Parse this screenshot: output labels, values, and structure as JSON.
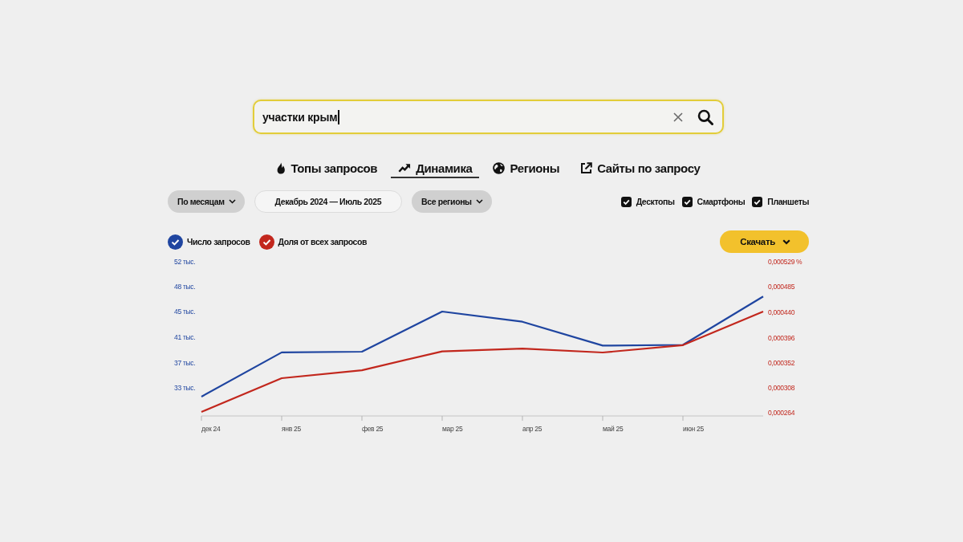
{
  "search": {
    "value": "участки крым"
  },
  "tabs": [
    {
      "label": "Топы запросов",
      "selected": false
    },
    {
      "label": "Динамика",
      "selected": true
    },
    {
      "label": "Регионы",
      "selected": false
    },
    {
      "label": "Сайты по запросу",
      "selected": false
    }
  ],
  "filters": [
    {
      "kind": "dropdown",
      "label": "По месяцам"
    },
    {
      "kind": "range",
      "label": "Декабрь 2024 — Июль 2025"
    },
    {
      "kind": "dropdown",
      "label": "Все регионы"
    }
  ],
  "devices": [
    {
      "label": "Десктопы",
      "checked": true
    },
    {
      "label": "Смартфоны",
      "checked": true
    },
    {
      "label": "Планшеты",
      "checked": true
    }
  ],
  "download_button": {
    "label": "Скачать"
  },
  "dynamics_chart": {
    "legend": [
      {
        "checked": true
      },
      {
        "checked": true
      }
    ],
    "chart_data": {
      "type": "line",
      "categories": [
        "дек 24",
        "янв 25",
        "фев 25",
        "мар 25",
        "апр 25",
        "май 25",
        "июн 25",
        null
      ],
      "ylim": [
        29.7,
        51.9
      ],
      "yticks": [
        {
          "value": 33.4,
          "label": "33 тыс."
        },
        {
          "value": 37.1,
          "label": "37 тыс."
        },
        {
          "value": 40.8,
          "label": "41 тыс."
        },
        {
          "value": 44.6,
          "label": "45 тыс."
        },
        {
          "value": 48.2,
          "label": "48 тыс."
        },
        {
          "value": 51.9,
          "label": "52 тыс."
        }
      ],
      "y2lim": [
        0.000264,
        0.000529
      ],
      "y2ticks": [
        {
          "value": 0.000264,
          "label": "0,000264"
        },
        {
          "value": 0.000308,
          "label": "0,000308"
        },
        {
          "value": 0.000352,
          "label": "0,000352"
        },
        {
          "value": 0.000396,
          "label": "0,000396"
        },
        {
          "value": 0.00044,
          "label": "0,000440"
        },
        {
          "value": 0.000485,
          "label": "0,000485"
        },
        {
          "value": 0.000529,
          "label": "0,000529 %"
        }
      ],
      "series": [
        {
          "name": "Число запросов",
          "color": "#1f45a0",
          "values": [
            32.1,
            38.6,
            38.7,
            44.6,
            43.1,
            39.6,
            39.7,
            46.8
          ]
        },
        {
          "name": "Доля от всех запросов",
          "color": "#c2271d",
          "axis": "y2",
          "values": [
            0.000266,
            0.000325,
            0.000339,
            0.000372,
            0.000377,
            0.00037,
            0.000383,
            0.000442
          ]
        }
      ]
    }
  }
}
